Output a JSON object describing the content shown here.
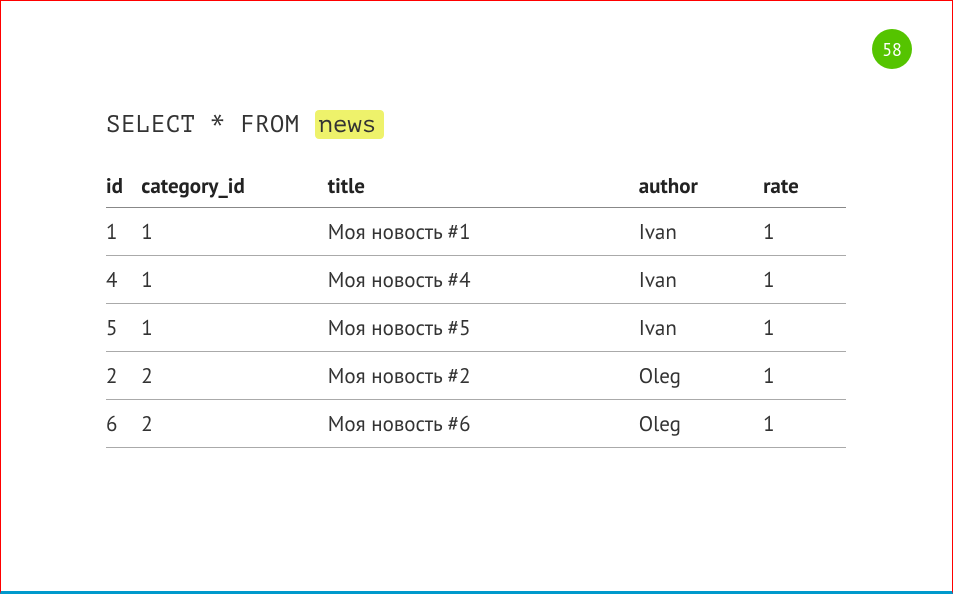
{
  "page_number": "58",
  "query": {
    "prefix": "SELECT * FROM ",
    "highlighted": "news"
  },
  "table": {
    "headers": [
      "id",
      "category_id",
      "title",
      "author",
      "rate"
    ],
    "rows": [
      {
        "id": "1",
        "category_id": "1",
        "title": "Моя новость #1",
        "author": "Ivan",
        "rate": "1"
      },
      {
        "id": "4",
        "category_id": "1",
        "title": "Моя новость #4",
        "author": "Ivan",
        "rate": "1"
      },
      {
        "id": "5",
        "category_id": "1",
        "title": "Моя новость #5",
        "author": "Ivan",
        "rate": "1"
      },
      {
        "id": "2",
        "category_id": "2",
        "title": "Моя новость #2",
        "author": "Oleg",
        "rate": "1"
      },
      {
        "id": "6",
        "category_id": "2",
        "title": "Моя новость #6",
        "author": "Oleg",
        "rate": "1"
      }
    ]
  }
}
